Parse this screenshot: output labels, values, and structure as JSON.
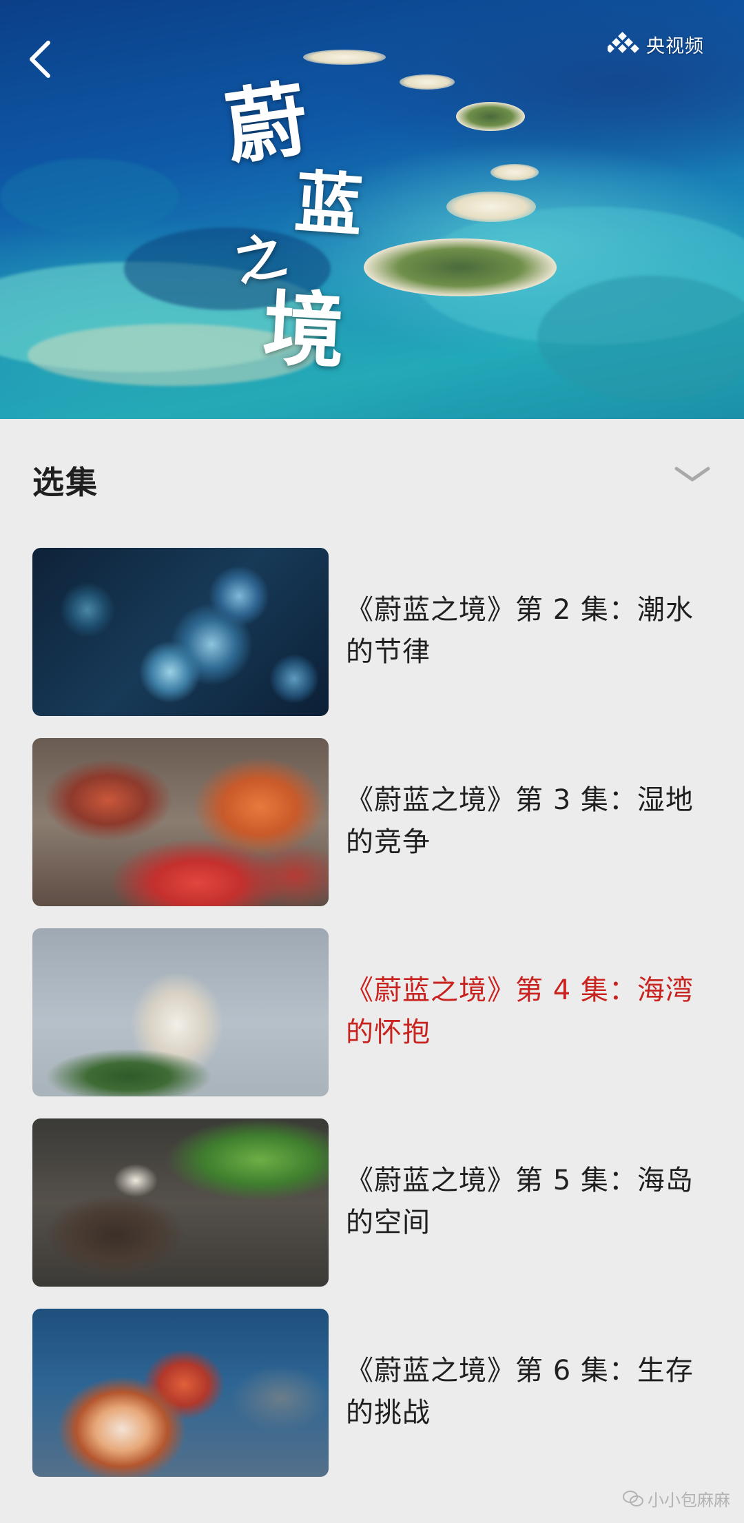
{
  "hero": {
    "title_chars": [
      "蔚",
      "蓝",
      "之",
      "境"
    ],
    "brand": "央视频"
  },
  "episodes_section": {
    "title": "选集"
  },
  "episodes": [
    {
      "title": "《蔚蓝之境》第 2 集：潮水的节律",
      "active": false
    },
    {
      "title": "《蔚蓝之境》第 3 集：湿地的竞争",
      "active": false
    },
    {
      "title": "《蔚蓝之境》第 4 集：海湾的怀抱",
      "active": true
    },
    {
      "title": "《蔚蓝之境》第 5 集：海岛的空间",
      "active": false
    },
    {
      "title": "《蔚蓝之境》第 6 集：生存的挑战",
      "active": false
    }
  ],
  "watermark": "小小包麻麻",
  "colors": {
    "active_title": "#c8231f",
    "background": "#ececec"
  }
}
